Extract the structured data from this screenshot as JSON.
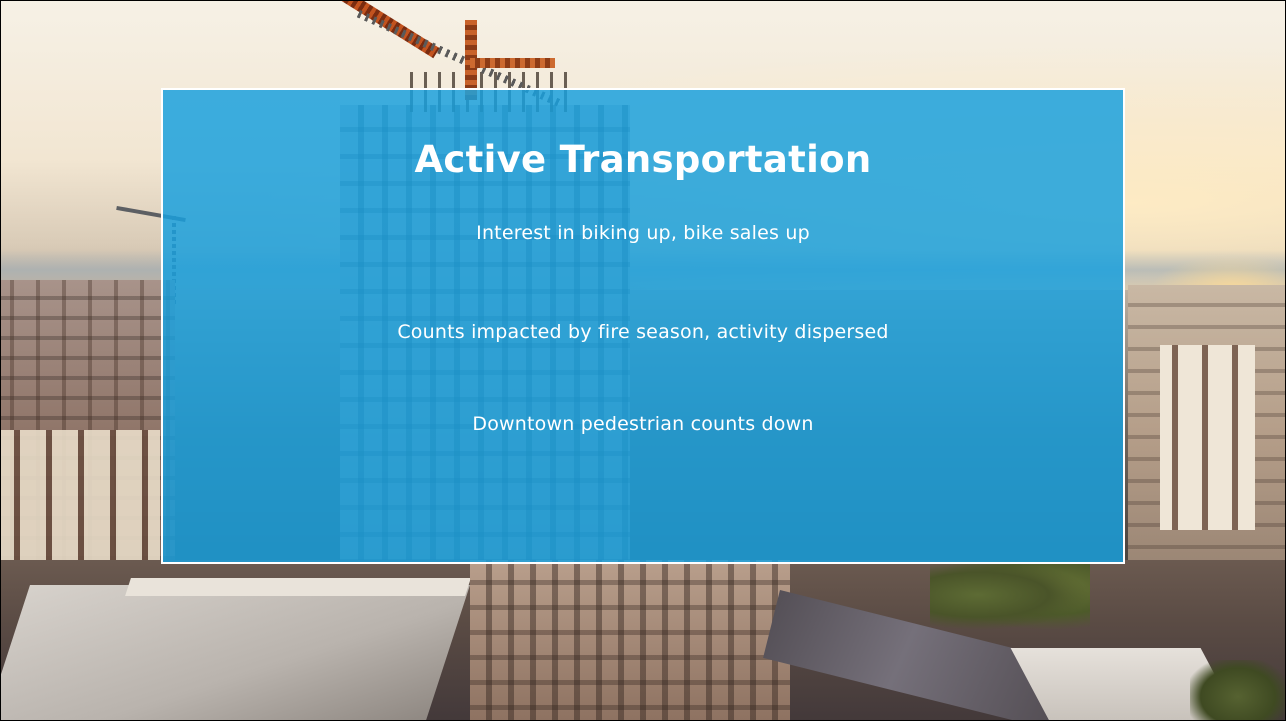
{
  "slide": {
    "title": "Active Transportation",
    "bullets": [
      "Interest in biking up, bike sales up",
      "Counts impacted by fire season, activity dispersed",
      "Downtown pedestrian counts down"
    ]
  },
  "colors": {
    "panel_fill": "#18a0de",
    "panel_border": "#ffffff",
    "text": "#ffffff"
  }
}
